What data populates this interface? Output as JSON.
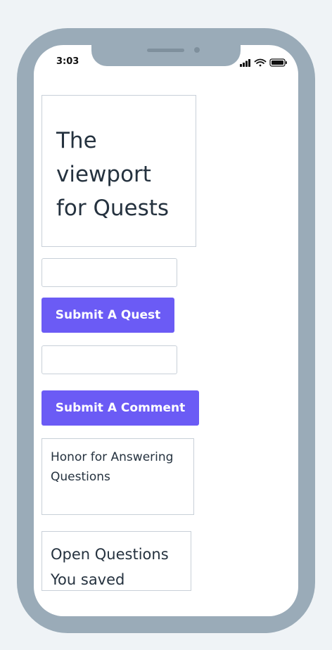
{
  "status_bar": {
    "time": "3:03",
    "icons": [
      "signal-icon",
      "wifi-icon",
      "battery-icon"
    ]
  },
  "viewport": {
    "title": "The viewport for Quests"
  },
  "quest_form": {
    "input_value": "",
    "input_placeholder": "",
    "submit_label": "Submit A Quest"
  },
  "comment_form": {
    "input_value": "",
    "input_placeholder": "",
    "submit_label": "Submit A Comment"
  },
  "honor_panel": {
    "text": "Honor for Answering Questions"
  },
  "saved_panel": {
    "text": "Open Questions You saved"
  },
  "colors": {
    "accent": "#6b5bf5",
    "frame": "#9aabb8",
    "border": "#c8d0d8",
    "text": "#25323f"
  }
}
